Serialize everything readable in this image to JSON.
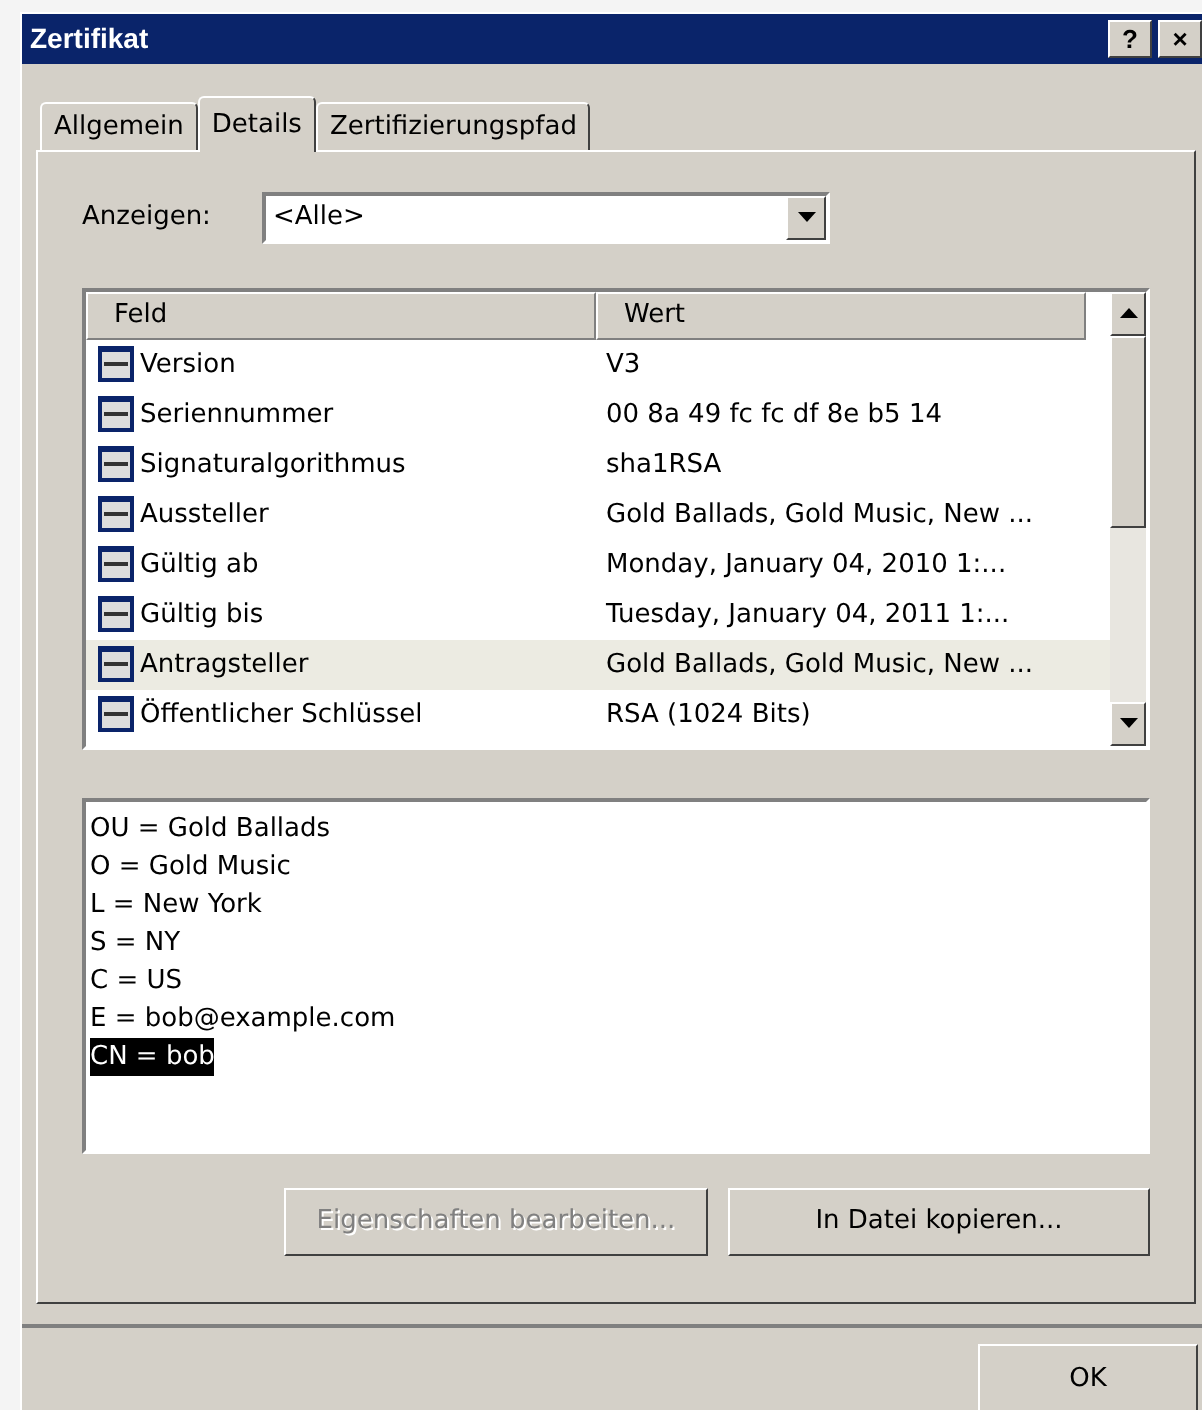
{
  "window": {
    "title": "Zertifikat",
    "controls": [
      "?",
      "×"
    ]
  },
  "tabs": [
    {
      "label": "Allgemein",
      "selected": false
    },
    {
      "label": "Details",
      "selected": true
    },
    {
      "label": "Zertifizierungspfad",
      "selected": false
    }
  ],
  "show": {
    "label": "Anzeigen:",
    "value": "<Alle>"
  },
  "table": {
    "columns": [
      "Feld",
      "Wert"
    ],
    "rows": [
      {
        "field": "Version",
        "value": "V3",
        "selected": false
      },
      {
        "field": "Seriennummer",
        "value": "00 8a 49 fc fc df 8e b5 14",
        "selected": false
      },
      {
        "field": "Signaturalgorithmus",
        "value": "sha1RSA",
        "selected": false
      },
      {
        "field": "Aussteller",
        "value": "Gold Ballads, Gold Music, New ...",
        "selected": false
      },
      {
        "field": "Gültig ab",
        "value": "Monday, January 04, 2010 1:...",
        "selected": false
      },
      {
        "field": "Gültig bis",
        "value": "Tuesday, January 04, 2011 1:...",
        "selected": false
      },
      {
        "field": "Antragsteller",
        "value": "Gold Ballads, Gold Music, New ...",
        "selected": true
      },
      {
        "field": "Öffentlicher Schlüssel",
        "value": "RSA (1024 Bits)",
        "selected": false
      }
    ]
  },
  "detail": {
    "lines": [
      {
        "text": "OU = Gold Ballads",
        "selected": false
      },
      {
        "text": "O = Gold Music",
        "selected": false
      },
      {
        "text": "L = New York",
        "selected": false
      },
      {
        "text": "S = NY",
        "selected": false
      },
      {
        "text": "C = US",
        "selected": false
      },
      {
        "text": "E = bob@example.com",
        "selected": false
      },
      {
        "text": "CN = bob",
        "selected": true
      }
    ]
  },
  "buttons": [
    {
      "label": "Eigenschaften bearbeiten...",
      "disabled": true
    },
    {
      "label": "In Datei kopieren...",
      "disabled": false
    }
  ],
  "footer_buttons": [
    {
      "label": "OK",
      "disabled": false
    }
  ]
}
